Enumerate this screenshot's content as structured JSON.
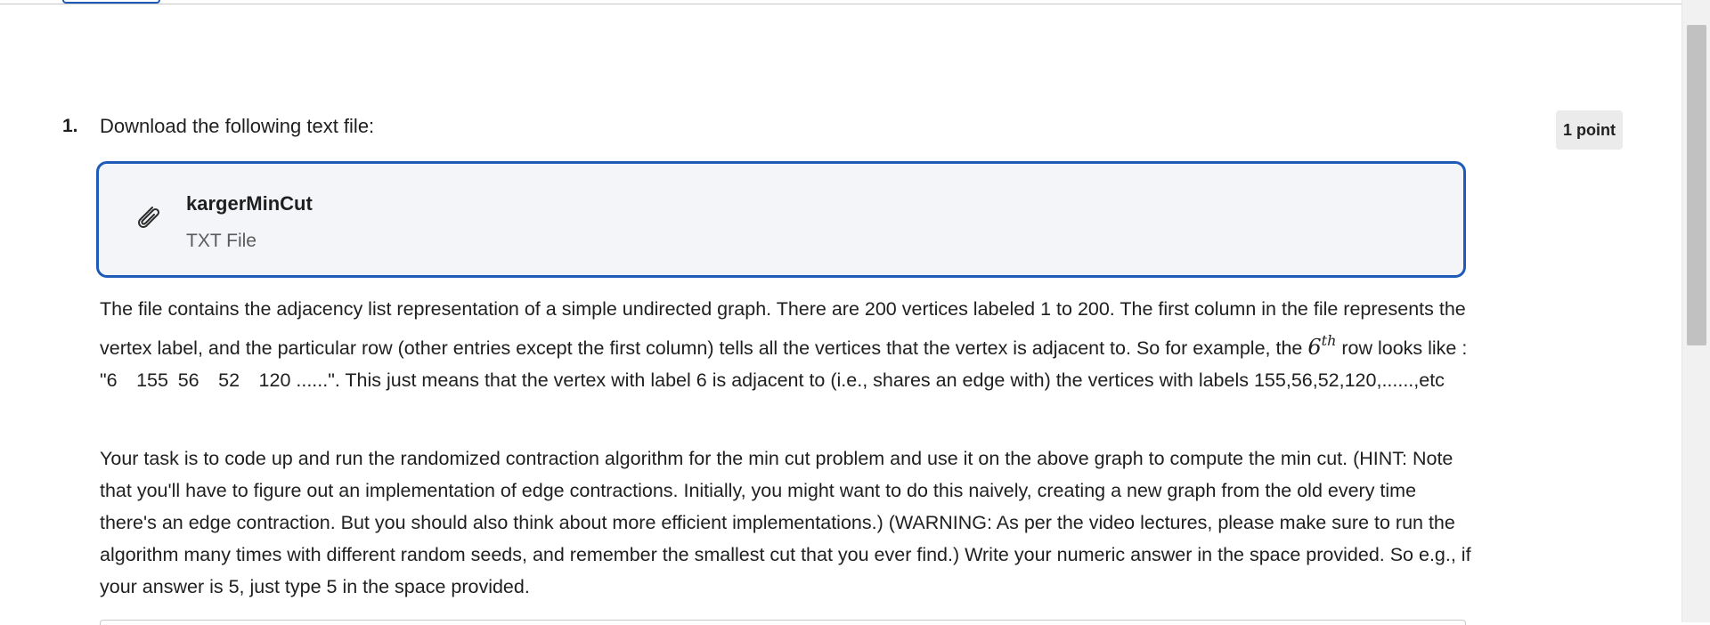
{
  "question": {
    "number": "1.",
    "prompt": "Download the following text file:",
    "points": "1 point"
  },
  "attachment": {
    "name": "kargerMinCut",
    "type": "TXT File",
    "icon": "paperclip-icon"
  },
  "body": {
    "para1_part1": "The file contains the adjacency list representation of a simple undirected graph. There are 200 vertices labeled 1 to 200. The first column in the file represents the vertex label, and the particular row (other entries except the first column) tells all the vertices that the vertex is adjacent to. So for example, the ",
    "para1_math_base": "6",
    "para1_math_sup": "th",
    "para1_part2": " row looks like : \"6 155 56 52 120 ......\". This just means that the vertex with label 6 is adjacent to (i.e., shares an edge with) the vertices with labels 155,56,52,120,......,etc",
    "para2": "Your task is to code up and run the randomized contraction algorithm for the min cut problem and use it on the above graph to compute the min cut.  (HINT: Note that you'll have to figure out an implementation of edge contractions.  Initially, you might want to do this naively, creating a new graph from the old every time there's an edge contraction.  But you should also think about more efficient implementations.)   (WARNING: As per the video lectures, please make sure to run the algorithm many times with different random seeds, and remember the smallest cut that you ever find.)  Write your numeric answer in the space provided.  So e.g., if your answer is 5, just type 5 in the space provided."
  },
  "colors": {
    "accent": "#1e5bb8",
    "card_bg": "#f3f5f8",
    "badge_bg": "#ebebeb"
  }
}
